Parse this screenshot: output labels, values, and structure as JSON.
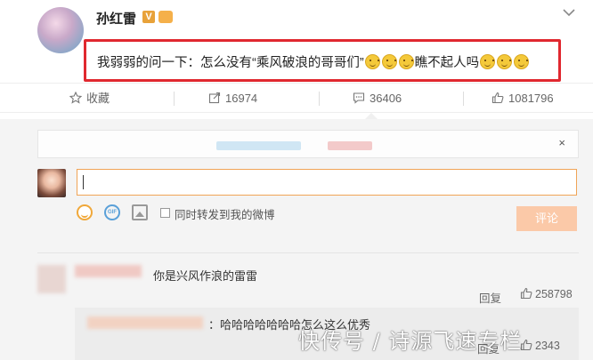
{
  "post": {
    "author": "孙红雷",
    "verified_badge": "V",
    "content_before": "我弱弱的问一下：怎么没有“乘风破浪的哥哥们”",
    "content_after": "瞧不起人吗",
    "emoji_icon": "smile-emoji"
  },
  "actions": {
    "favorite_label": "收藏",
    "forward_count": "16974",
    "comment_count": "36406",
    "like_count": "1081796"
  },
  "composer": {
    "notice_close": "×",
    "input_value": "",
    "forward_option_label": "同时转发到我的微博",
    "submit_label": "评论"
  },
  "comments": [
    {
      "text": "你是兴风作浪的雷雷",
      "reply_label": "回复",
      "like_count": "258798",
      "replies": [
        {
          "text": "：哈哈哈哈哈哈哈怎么这么优秀",
          "reply_label": "回复",
          "like_count": "2343"
        }
      ]
    }
  ],
  "watermark": "快传号 / 诗源飞速专栏",
  "colors": {
    "highlight_border": "#e0282f",
    "input_border": "#f0a456",
    "submit_bg": "#fbc9a8"
  }
}
